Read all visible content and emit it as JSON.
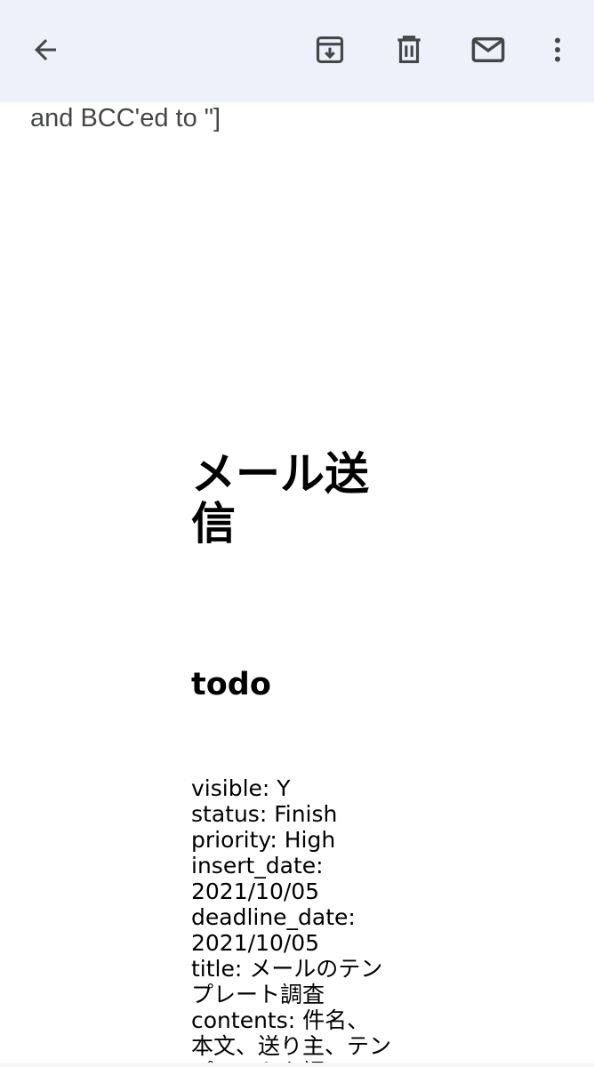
{
  "toolbar": {
    "icons": [
      "back-arrow-icon",
      "archive-icon",
      "delete-icon",
      "mail-icon",
      "more-vert-icon"
    ],
    "background": "#edf2fa",
    "icon_color": "#444746"
  },
  "message": {
    "snippet": "and BCC'ed to \"]",
    "heading": "メール送信",
    "subheading": "todo",
    "fields": [
      "visible: Y",
      "status: Finish",
      "priority: High",
      "insert_date: 2021/10/05",
      "deadline_date: 2021/10/05",
      "title: メールのテンプレート調査",
      "contents: 件名、本文、送り主、テンプレートを調べ"
    ]
  }
}
